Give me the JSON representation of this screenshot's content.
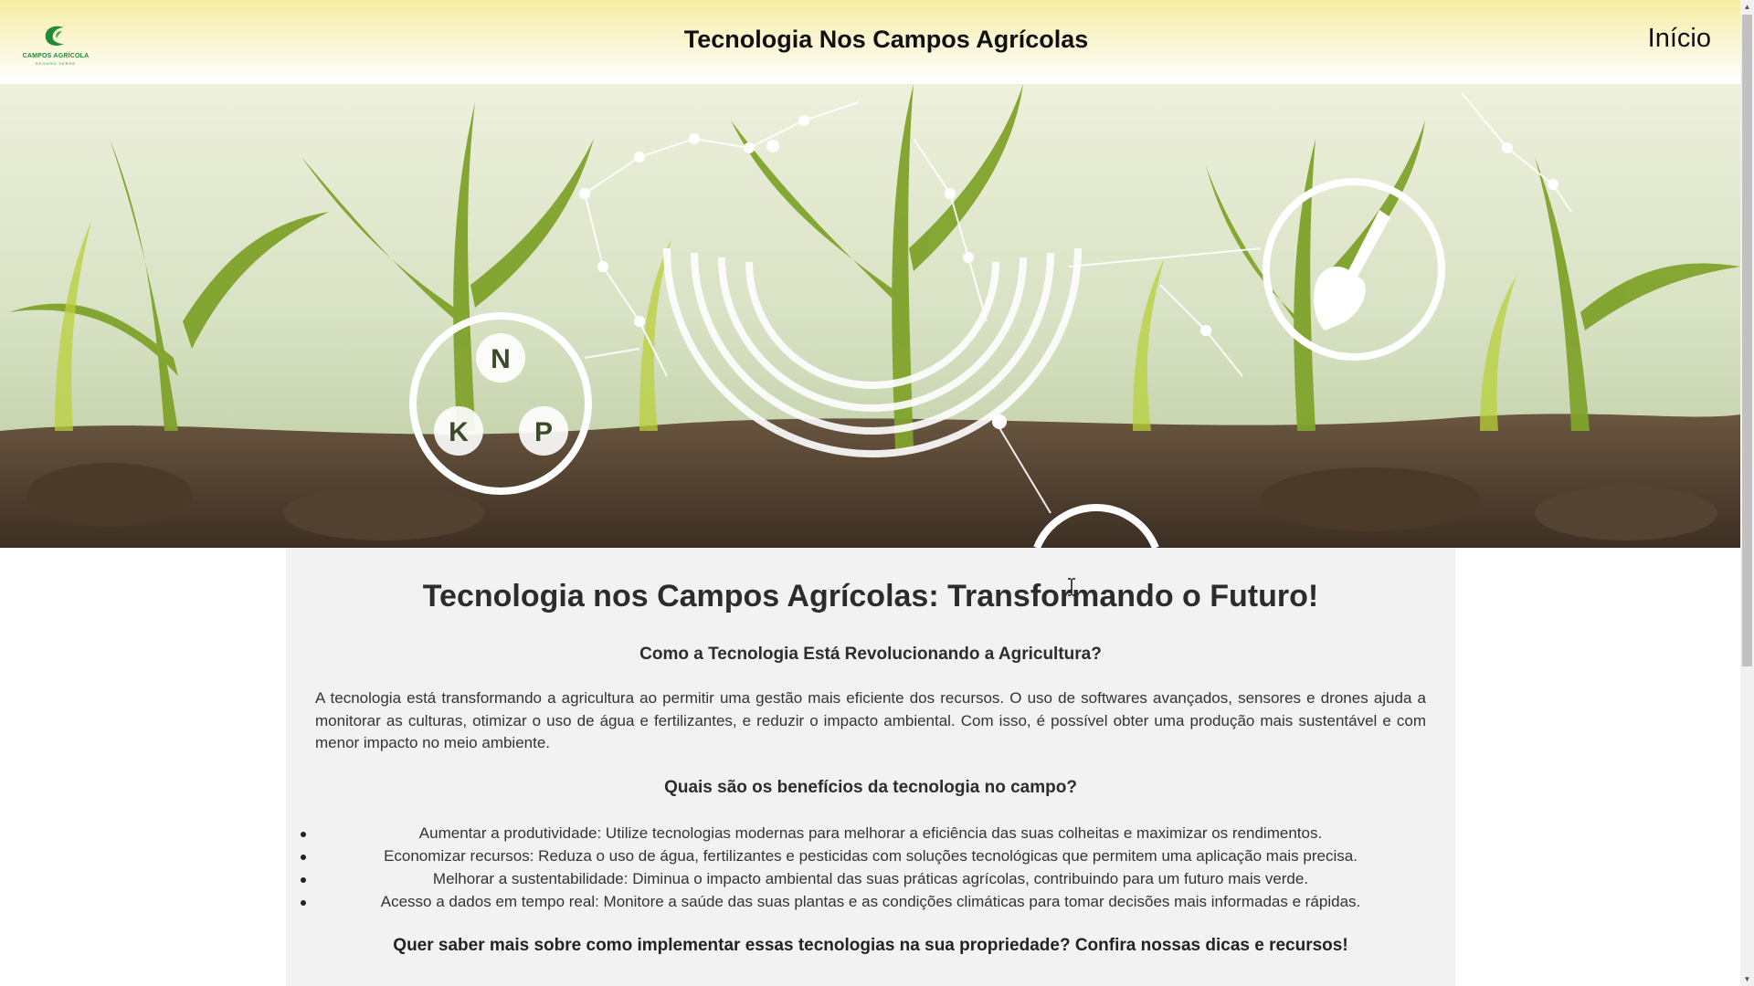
{
  "header": {
    "logo_text": "CAMPOS AGRÍCOLA",
    "logo_subtext": "SEGURO VERDE",
    "title": "Tecnologia Nos Campos Agrícolas",
    "nav_inicio": "Início"
  },
  "hero": {
    "nutrient_labels": [
      "N",
      "K",
      "P"
    ],
    "icons": [
      "npk-nutrients-icon",
      "shovel-icon",
      "circular-data-rings-icon"
    ]
  },
  "article": {
    "heading": "Tecnologia nos Campos Agrícolas: Transformando o Futuro!",
    "subheading1": "Como a Tecnologia Está Revolucionando a Agricultura?",
    "paragraph": "A tecnologia está transformando a agricultura ao permitir uma gestão mais eficiente dos recursos. O uso de softwares avançados, sensores e drones ajuda a monitorar as culturas, otimizar o uso de água e fertilizantes, e reduzir o impacto ambiental. Com isso, é possível obter uma produção mais sustentável e com menor impacto no meio ambiente.",
    "subheading2": "Quais são os benefícios da tecnologia no campo?",
    "benefits": [
      "Aumentar a produtividade: Utilize tecnologias modernas para melhorar a eficiência das suas colheitas e maximizar os rendimentos.",
      "Economizar recursos: Reduza o uso de água, fertilizantes e pesticidas com soluções tecnológicas que permitem uma aplicação mais precisa.",
      "Melhorar a sustentabilidade: Diminua o impacto ambiental das suas práticas agrícolas, contribuindo para um futuro mais verde.",
      "Acesso a dados em tempo real: Monitore a saúde das suas plantas e as condições climáticas para tomar decisões mais informadas e rápidas."
    ],
    "cta": "Quer saber mais sobre como implementar essas tecnologias na sua propriedade? Confira nossas dicas e recursos!"
  },
  "colors": {
    "header_yellow": "#f5eda0",
    "brand_green": "#1f8a3a",
    "article_bg": "#f2f2f2"
  }
}
